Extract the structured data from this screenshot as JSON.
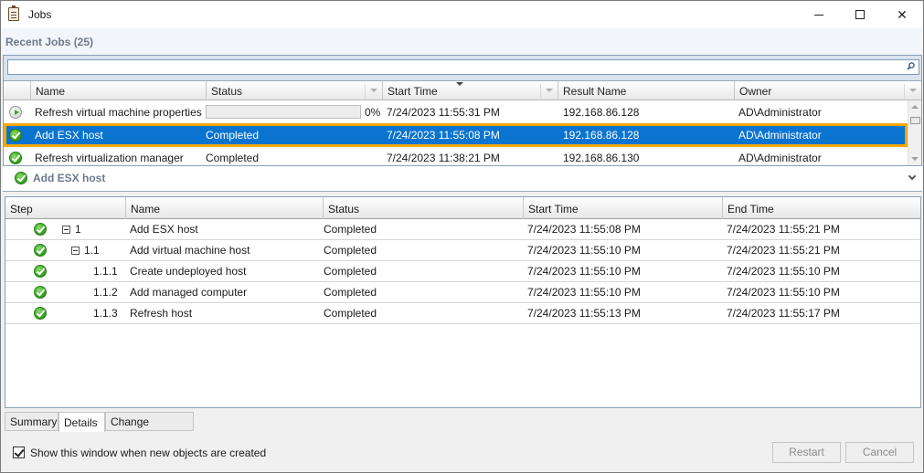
{
  "window": {
    "title": "Jobs",
    "icon": "clipboard-icon",
    "controls": {
      "minimize": "minimize-icon",
      "maximize": "maximize-icon",
      "close": "close-icon"
    }
  },
  "recent": {
    "title": "Recent Jobs (25)",
    "search": {
      "value": "",
      "placeholder": "",
      "icon": "search-icon"
    },
    "columns": [
      "Name",
      "Status",
      "Start Time",
      "Result Name",
      "Owner"
    ],
    "sorted_column": "Start Time",
    "rows": [
      {
        "icon": "running-icon",
        "name": "Refresh virtual machine properties",
        "status": "",
        "progress_percent": 0,
        "progress_label": "0%",
        "start_time": "7/24/2023 11:55:31 PM",
        "result_name": "192.168.86.128",
        "owner": "AD\\Administrator",
        "selected": false
      },
      {
        "icon": "completed-icon",
        "name": "Add ESX host",
        "status": "Completed",
        "start_time": "7/24/2023 11:55:08 PM",
        "result_name": "192.168.86.128",
        "owner": "AD\\Administrator",
        "selected": true
      },
      {
        "icon": "completed-icon",
        "name": "Refresh virtualization manager",
        "status": "Completed",
        "start_time": "7/24/2023 11:38:21 PM",
        "result_name": "192.168.86.130",
        "owner": "AD\\Administrator",
        "selected": false
      }
    ]
  },
  "detail": {
    "title": "Add ESX host",
    "columns": [
      "Step",
      "Name",
      "Status",
      "Start Time",
      "End Time"
    ],
    "steps": [
      {
        "step": "1",
        "expandable": true,
        "name": "Add ESX host",
        "status": "Completed",
        "start_time": "7/24/2023 11:55:08 PM",
        "end_time": "7/24/2023 11:55:21 PM"
      },
      {
        "step": "1.1",
        "expandable": true,
        "name": "Add virtual machine host",
        "status": "Completed",
        "start_time": "7/24/2023 11:55:10 PM",
        "end_time": "7/24/2023 11:55:21 PM"
      },
      {
        "step": "1.1.1",
        "expandable": false,
        "name": "Create undeployed host",
        "status": "Completed",
        "start_time": "7/24/2023 11:55:10 PM",
        "end_time": "7/24/2023 11:55:10 PM"
      },
      {
        "step": "1.1.2",
        "expandable": false,
        "name": "Add managed computer",
        "status": "Completed",
        "start_time": "7/24/2023 11:55:10 PM",
        "end_time": "7/24/2023 11:55:10 PM"
      },
      {
        "step": "1.1.3",
        "expandable": false,
        "name": "Refresh host",
        "status": "Completed",
        "start_time": "7/24/2023 11:55:13 PM",
        "end_time": "7/24/2023 11:55:17 PM"
      }
    ]
  },
  "tabs": [
    {
      "label": "Summary",
      "active": false
    },
    {
      "label": "Details",
      "active": true
    },
    {
      "label": "Change Tracking",
      "active": false
    }
  ],
  "footer": {
    "checkbox_label": "Show this window when new objects are created",
    "checkbox_checked": true,
    "restart_label": "Restart",
    "cancel_label": "Cancel"
  },
  "colors": {
    "selection": "#0a74d0",
    "selection_outline": "#f2a900",
    "status_ok": "#2f9a1d"
  }
}
